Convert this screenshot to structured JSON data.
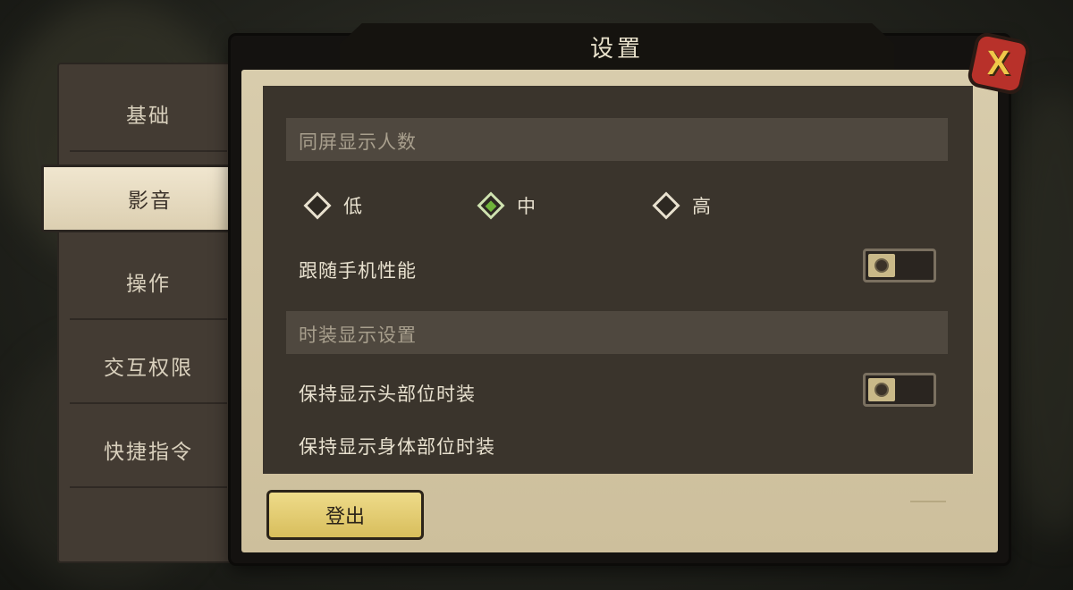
{
  "window": {
    "title": "设置",
    "close_label": "X"
  },
  "tabs": [
    {
      "label": "基础",
      "active": false
    },
    {
      "label": "影音",
      "active": true
    },
    {
      "label": "操作",
      "active": false
    },
    {
      "label": "交互权限",
      "active": false
    },
    {
      "label": "快捷指令",
      "active": false
    }
  ],
  "content": {
    "section1": {
      "title": "同屏显示人数"
    },
    "options": [
      {
        "label": "低",
        "selected": false
      },
      {
        "label": "中",
        "selected": true
      },
      {
        "label": "高",
        "selected": false
      }
    ],
    "follow_phone": {
      "label": "跟随手机性能"
    },
    "section2": {
      "title": "时装显示设置"
    },
    "keep_head": {
      "label": "保持显示头部位时装"
    },
    "keep_body": {
      "label": "保持显示身体部位时装"
    }
  },
  "footer": {
    "logout_label": "登出"
  },
  "colors": {
    "accent": "#6fb33a",
    "button": "#e3cc70",
    "close": "#b8312a"
  }
}
